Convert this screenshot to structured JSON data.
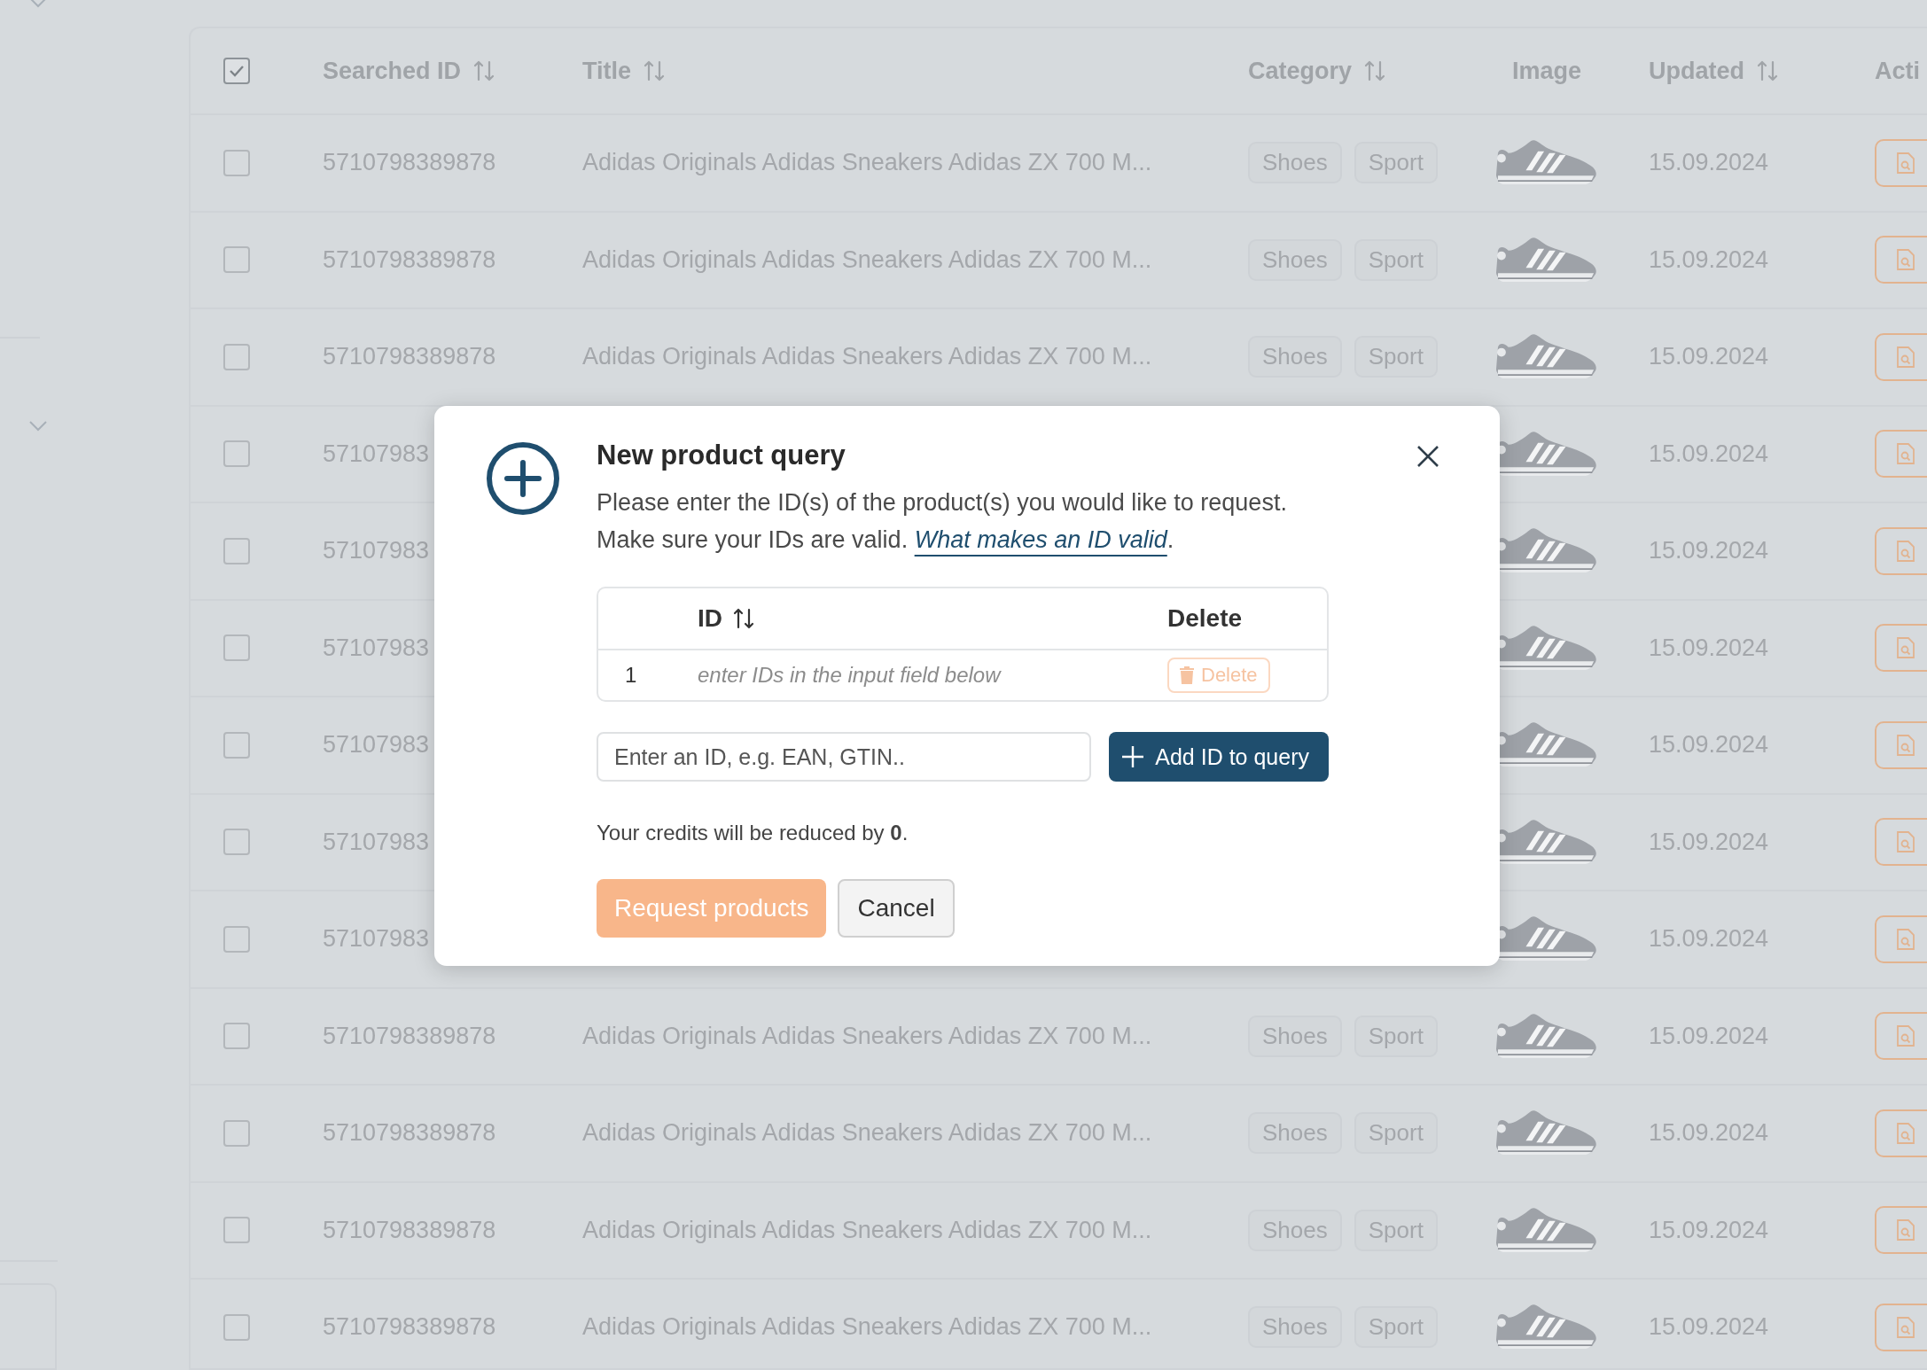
{
  "table": {
    "header_checked": true,
    "columns": [
      {
        "label": "Searched ID",
        "sortable": true
      },
      {
        "label": "Title",
        "sortable": true
      },
      {
        "label": "Category",
        "sortable": true
      },
      {
        "label": "Image",
        "sortable": false
      },
      {
        "label": "Updated",
        "sortable": true
      },
      {
        "label": "Acti"
      }
    ],
    "rows": [
      {
        "checked": false,
        "id": "5710798389878",
        "title": "Adidas Originals Adidas Sneakers Adidas ZX 700 M...",
        "categories": [
          "Shoes",
          "Sport"
        ],
        "updated": "15.09.2024"
      },
      {
        "checked": false,
        "id": "5710798389878",
        "title": "Adidas Originals Adidas Sneakers Adidas ZX 700 M...",
        "categories": [
          "Shoes",
          "Sport"
        ],
        "updated": "15.09.2024"
      },
      {
        "checked": false,
        "id": "5710798389878",
        "title": "Adidas Originals Adidas Sneakers Adidas ZX 700 M...",
        "categories": [
          "Shoes",
          "Sport"
        ],
        "updated": "15.09.2024"
      },
      {
        "checked": false,
        "id": "57107983",
        "updated": "15.09.2024"
      },
      {
        "checked": false,
        "id": "57107983",
        "updated": "15.09.2024"
      },
      {
        "checked": false,
        "id": "57107983",
        "updated": "15.09.2024"
      },
      {
        "checked": false,
        "id": "57107983",
        "updated": "15.09.2024"
      },
      {
        "checked": false,
        "id": "57107983",
        "updated": "15.09.2024"
      },
      {
        "checked": false,
        "id": "57107983",
        "updated": "15.09.2024"
      },
      {
        "checked": false,
        "id": "5710798389878",
        "title": "Adidas Originals Adidas Sneakers Adidas ZX 700 M...",
        "categories": [
          "Shoes",
          "Sport"
        ],
        "updated": "15.09.2024"
      },
      {
        "checked": false,
        "id": "5710798389878",
        "title": "Adidas Originals Adidas Sneakers Adidas ZX 700 M...",
        "categories": [
          "Shoes",
          "Sport"
        ],
        "updated": "15.09.2024"
      },
      {
        "checked": false,
        "id": "5710798389878",
        "title": "Adidas Originals Adidas Sneakers Adidas ZX 700 M...",
        "categories": [
          "Shoes",
          "Sport"
        ],
        "updated": "15.09.2024"
      },
      {
        "checked": false,
        "id": "5710798389878",
        "title": "Adidas Originals Adidas Sneakers Adidas ZX 700 M...",
        "categories": [
          "Shoes",
          "Sport"
        ],
        "updated": "15.09.2024"
      }
    ]
  },
  "dialog": {
    "title": "New product query",
    "description": "Please enter the ID(s) of the product(s) you would like to request. Make sure your IDs are valid.",
    "link": "What makes an ID valid",
    "link_suffix": ".",
    "id_table": {
      "columns": [
        {
          "label": "ID",
          "sortable": true
        },
        {
          "label": "Delete",
          "sortable": false
        }
      ],
      "rows": [
        {
          "number": "1",
          "placeholder": "enter IDs in the input field below",
          "delete_label": "Delete",
          "delete_disabled": true
        }
      ]
    },
    "input": {
      "placeholder": "Enter an ID, e.g. EAN, GTIN.."
    },
    "add_button": "Add ID to query",
    "credits_note": "Your credits will be reduced by **0**.",
    "buttons": [
      {
        "label": "Request products",
        "kind": "primary",
        "disabled": true
      },
      {
        "label": "Cancel",
        "kind": "secondary",
        "disabled": false
      }
    ]
  }
}
